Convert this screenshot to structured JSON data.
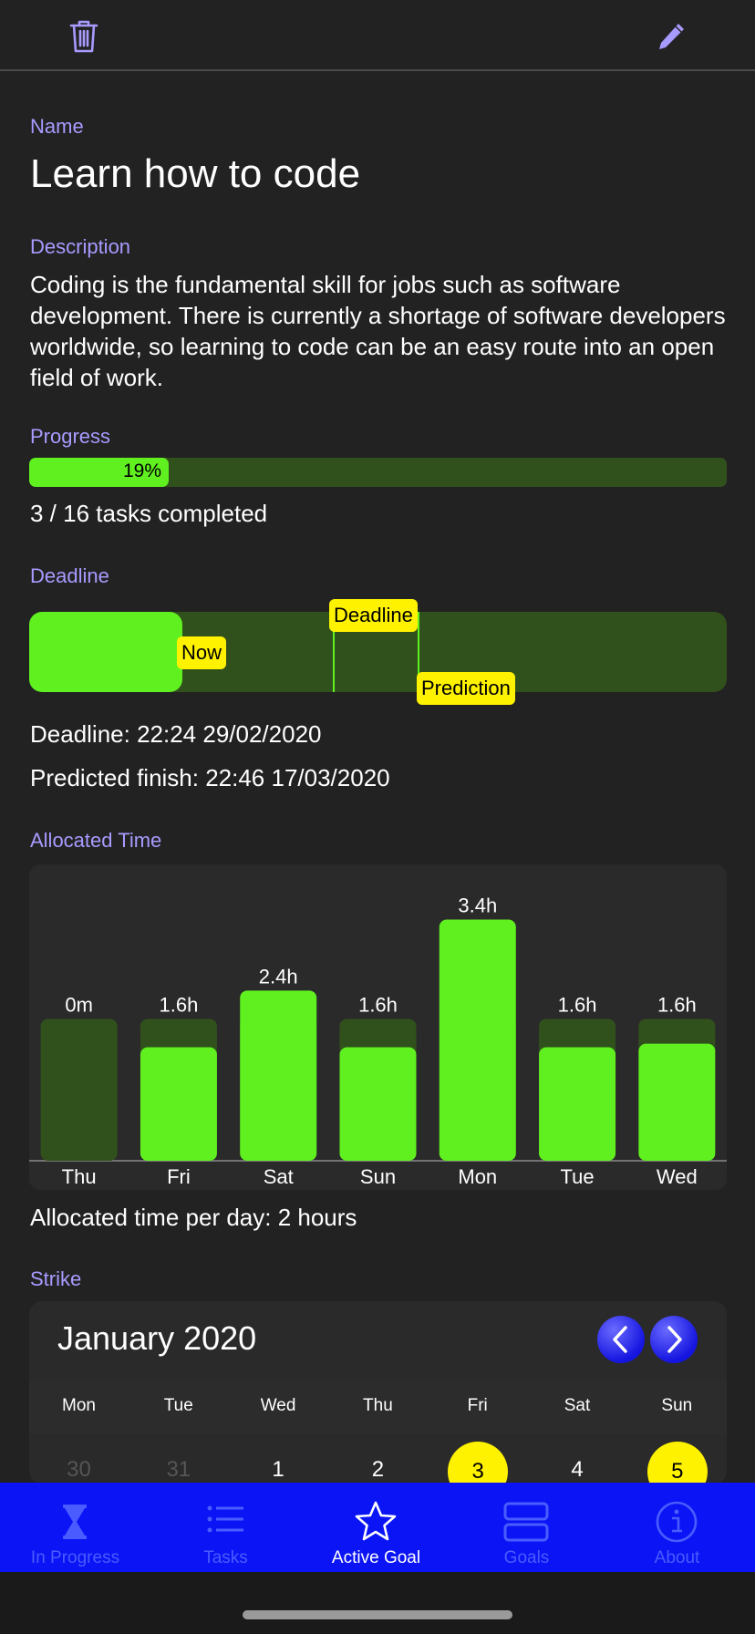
{
  "toolbar": {
    "left_icon": "trash-icon",
    "right_icon": "pencil-icon"
  },
  "goal": {
    "name_label": "Name",
    "name": "Learn how to code",
    "description_label": "Description",
    "description": "Coding is the fundamental skill for jobs such as software development. There is currently a shortage of software developers worldwide, so learning to code can be an easy route into an open field of work."
  },
  "progress": {
    "label": "Progress",
    "percent": 19,
    "percent_text": "19%",
    "summary": "3 / 16 tasks completed"
  },
  "deadline": {
    "label": "Deadline",
    "now_tag": "Now",
    "deadline_tag": "Deadline",
    "prediction_tag": "Prediction",
    "now_fraction": 0.22,
    "deadline_fraction": 0.435,
    "prediction_fraction": 0.557,
    "deadline_text": "Deadline: 22:24 29/02/2020",
    "predicted_text": "Predicted finish: 22:46 17/03/2020"
  },
  "allocated": {
    "label": "Allocated Time",
    "per_day_text": "Allocated time per day: 2 hours"
  },
  "chart_data": {
    "type": "bar",
    "categories": [
      "Thu",
      "Fri",
      "Sat",
      "Sun",
      "Mon",
      "Tue",
      "Wed"
    ],
    "target_hours": 2,
    "values": [
      0,
      1.6,
      2.4,
      1.6,
      3.4,
      1.6,
      1.65
    ],
    "value_labels": [
      "0m",
      "1.6h",
      "2.4h",
      "1.6h",
      "3.4h",
      "1.6h",
      "1.6h"
    ],
    "ylim": [
      0,
      3.6
    ],
    "colors": {
      "fill": "#60f020",
      "target": "#31511c"
    }
  },
  "strike": {
    "label": "Strike",
    "month": "January 2020",
    "prev_icon": "chevron-left-icon",
    "next_icon": "chevron-right-icon",
    "weekdays": [
      "Mon",
      "Tue",
      "Wed",
      "Thu",
      "Fri",
      "Sat",
      "Sun"
    ],
    "days": [
      {
        "num": "30",
        "muted": true,
        "highlight": false
      },
      {
        "num": "31",
        "muted": true,
        "highlight": false
      },
      {
        "num": "1",
        "muted": false,
        "highlight": false
      },
      {
        "num": "2",
        "muted": false,
        "highlight": false
      },
      {
        "num": "3",
        "muted": false,
        "highlight": true
      },
      {
        "num": "4",
        "muted": false,
        "highlight": false
      },
      {
        "num": "5",
        "muted": false,
        "highlight": true
      }
    ],
    "highlight_color": "#fff200"
  },
  "tabs": [
    {
      "label": "In Progress",
      "icon": "hourglass-icon",
      "active": false
    },
    {
      "label": "Tasks",
      "icon": "list-icon",
      "active": false
    },
    {
      "label": "Active Goal",
      "icon": "star-icon",
      "active": true
    },
    {
      "label": "Goals",
      "icon": "stack-icon",
      "active": false
    },
    {
      "label": "About",
      "icon": "info-icon",
      "active": false
    }
  ],
  "colors": {
    "accent": "#a79bff",
    "green": "#60f020",
    "dark_green": "#31511c",
    "yellow": "#fff200",
    "tabbar": "#0a14f5"
  }
}
